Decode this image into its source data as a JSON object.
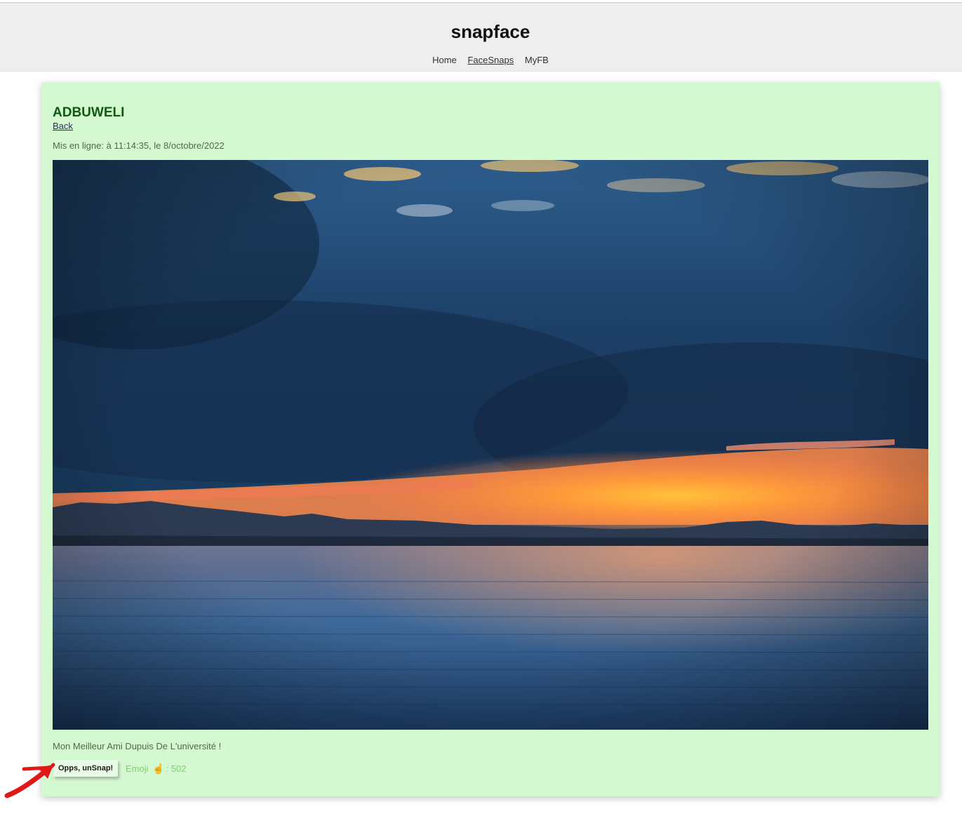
{
  "app": {
    "brand": "snapface"
  },
  "nav": {
    "items": [
      {
        "label": "Home",
        "active": false
      },
      {
        "label": "FaceSnaps",
        "active": true
      },
      {
        "label": "MyFB",
        "active": false
      }
    ]
  },
  "snap": {
    "title": "ADBUWELI",
    "back_label": "Back",
    "posted": "Mis en ligne: à 11:14:35, le 8/octobre/2022",
    "description": "Mon Meilleur Ami Dupuis De L'université !",
    "unsnap_label": "Opps, unSnap!",
    "emoji_label": "Emoji",
    "emoji_icon": "pointing-hand-icon",
    "emoji_separator": ":",
    "snaps_count": "502"
  },
  "colors": {
    "card_background": "#d4f8d0",
    "title_green": "#0e5a0e",
    "emoji_green": "#7cd36f",
    "header_gray": "#eeeeee",
    "annotation_red": "#e01818"
  },
  "annotation": {
    "icon": "red-arrow-icon"
  }
}
